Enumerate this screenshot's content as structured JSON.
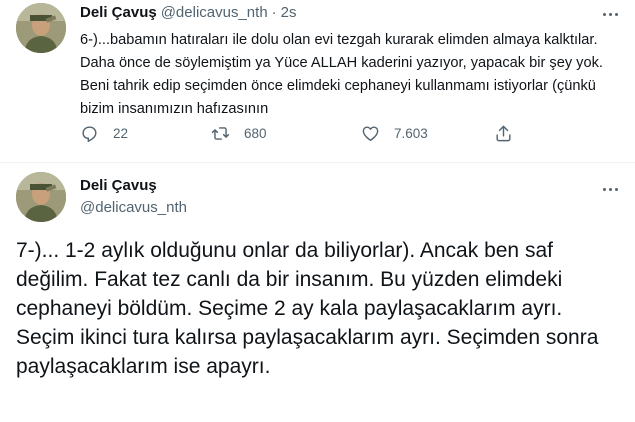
{
  "tweet1": {
    "author_name": "Deli Çavuş",
    "handle": "@delicavus_nth",
    "separator": "·",
    "time": "2s",
    "text": "6-)...babamın hatıraları ile dolu olan evi tezgah kurarak elimden almaya kalktılar. Daha önce de söylemiştim ya Yüce ALLAH kaderini yazıyor, yapacak bir şey yok. Beni tahrik edip seçimden önce elimdeki cephaneyi kullanmamı istiyorlar (çünkü bizim insanımızın hafızasının",
    "replies": "22",
    "retweets": "680",
    "likes": "7.603"
  },
  "tweet2": {
    "author_name": "Deli Çavuş",
    "handle": "@delicavus_nth",
    "text": "7-)... 1-2 aylık olduğunu onlar da biliyorlar). Ancak ben saf değilim. Fakat tez canlı da bir insanım. Bu yüzden elimdeki cephaneyi böldüm. Seçime 2 ay kala paylaşacaklarım ayrı. Seçim ikinci tura kalırsa paylaşacaklarım ayrı. Seçimden sonra paylaşacaklarım ise apayrı."
  },
  "icons": {
    "reply": "reply-icon",
    "retweet": "retweet-icon",
    "like": "heart-icon",
    "share": "share-icon",
    "more": "more-icon",
    "avatar": "avatar"
  },
  "colors": {
    "text": "#0f1419",
    "secondary": "#536471",
    "divider": "#eff3f4"
  }
}
